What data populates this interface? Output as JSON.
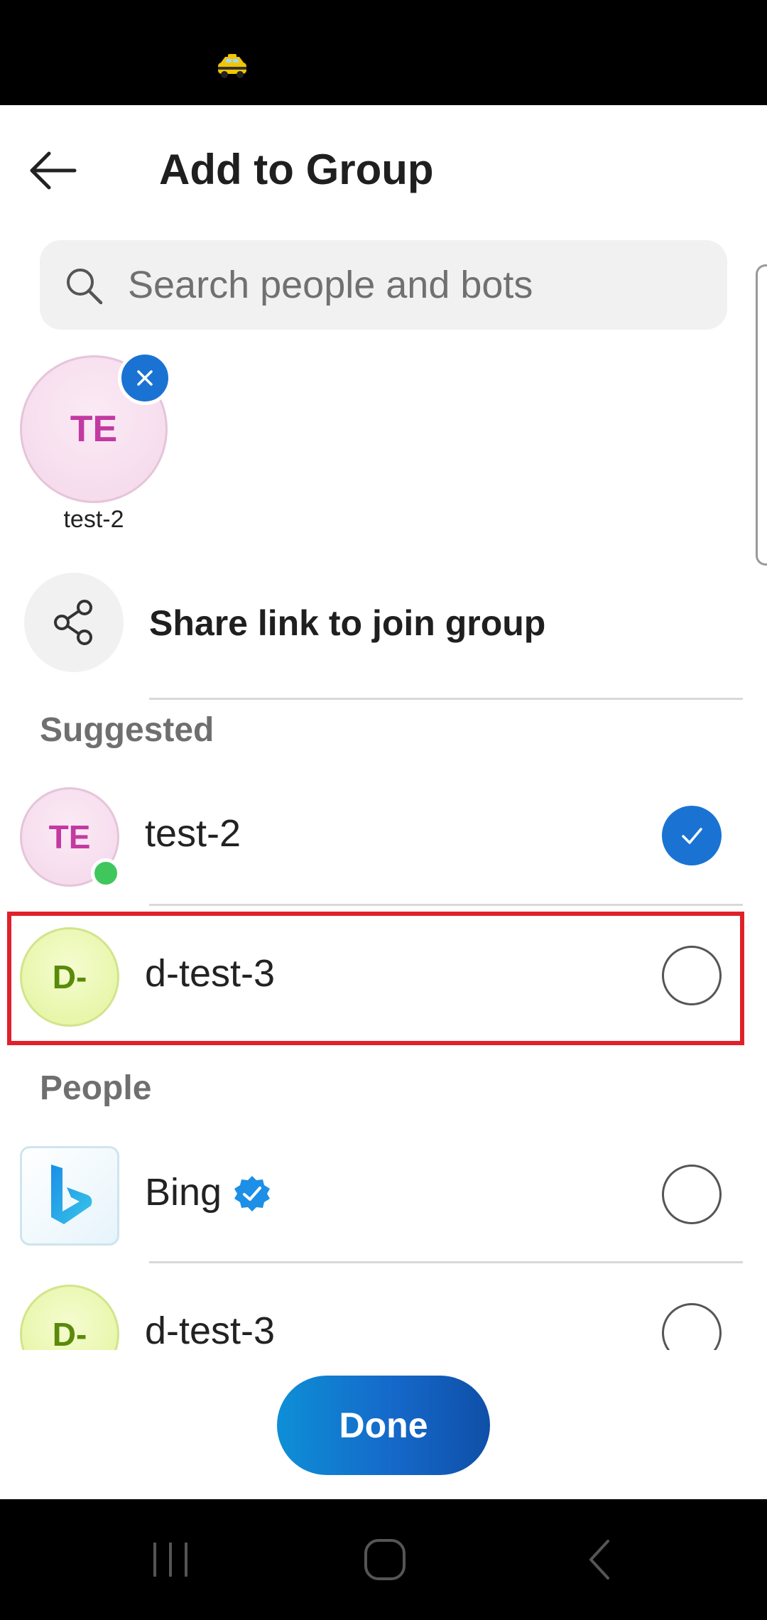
{
  "header": {
    "title": "Add to Group"
  },
  "search": {
    "placeholder": "Search people and bots"
  },
  "selected_chips": [
    {
      "initials": "TE",
      "label": "test-2"
    }
  ],
  "share": {
    "label": "Share link to join group"
  },
  "sections": {
    "suggested": "Suggested",
    "people": "People"
  },
  "suggested_items": [
    {
      "initials": "TE",
      "name": "test-2",
      "selected": true,
      "online": true
    },
    {
      "initials": "D-",
      "name": "d-test-3",
      "selected": false,
      "online": false
    }
  ],
  "people_items": [
    {
      "name": "Bing",
      "verified": true,
      "selected": false
    },
    {
      "initials": "D-",
      "name": "d-test-3",
      "selected": false
    }
  ],
  "footer": {
    "done_label": "Done"
  },
  "colors": {
    "accent": "#1a73d3",
    "highlight": "#e0202a",
    "presence": "#3fc75c"
  }
}
